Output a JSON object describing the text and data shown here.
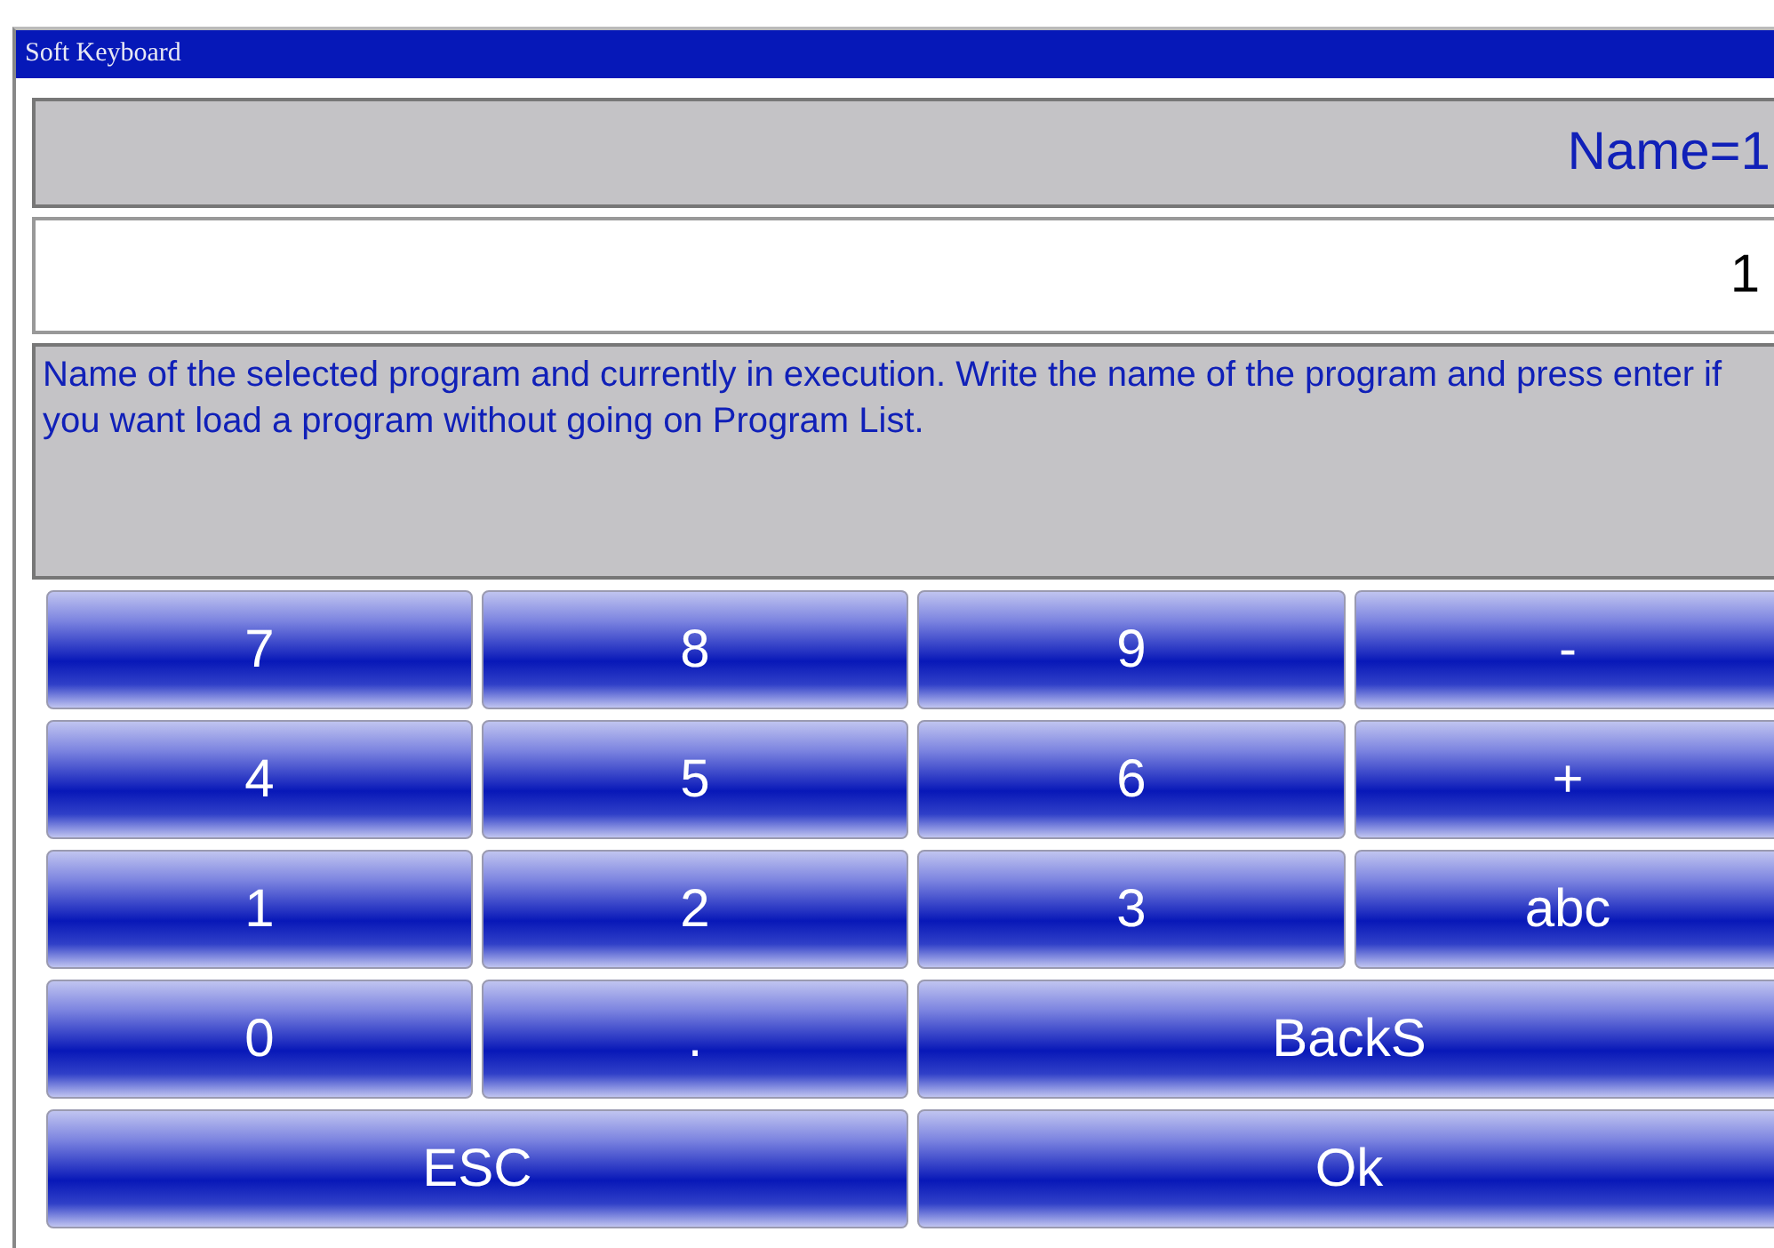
{
  "window": {
    "title": "Soft Keyboard"
  },
  "header": {
    "text": "Name=1"
  },
  "input": {
    "value": "1"
  },
  "description": {
    "text": "Name of the selected program and currently in execution. Write the name of the program and press enter if you want load a program without going on Program List."
  },
  "keys": [
    {
      "label": "7",
      "kind": "single"
    },
    {
      "label": "8",
      "kind": "single"
    },
    {
      "label": "9",
      "kind": "single"
    },
    {
      "label": "-",
      "kind": "single"
    },
    {
      "label": "4",
      "kind": "single"
    },
    {
      "label": "5",
      "kind": "single"
    },
    {
      "label": "6",
      "kind": "single"
    },
    {
      "label": "+",
      "kind": "single"
    },
    {
      "label": "1",
      "kind": "single"
    },
    {
      "label": "2",
      "kind": "single"
    },
    {
      "label": "3",
      "kind": "single"
    },
    {
      "label": "abc",
      "kind": "single"
    },
    {
      "label": "0",
      "kind": "single"
    },
    {
      "label": ".",
      "kind": "single"
    },
    {
      "label": "BackS",
      "kind": "wide"
    },
    {
      "label": "ESC",
      "kind": "wide"
    },
    {
      "label": "Ok",
      "kind": "wide"
    }
  ]
}
